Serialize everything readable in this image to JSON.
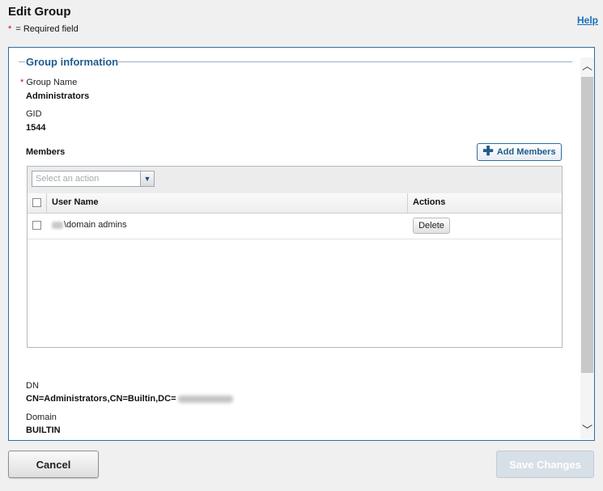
{
  "header": {
    "title": "Edit Group",
    "required_note": "= Required field",
    "required_star": "*",
    "help_link": "Help"
  },
  "group_info": {
    "legend": "Group information",
    "group_name_label": "Group Name",
    "group_name_value": "Administrators",
    "gid_label": "GID",
    "gid_value": "1544",
    "members_label": "Members",
    "add_members_label": "Add Members"
  },
  "members_grid": {
    "action_placeholder": "Select an action",
    "columns": [
      "User Name",
      "Actions"
    ],
    "rows": [
      {
        "user_name": "\\domain admins",
        "action": "Delete"
      }
    ]
  },
  "dn": {
    "label": "DN",
    "value": "CN=Administrators,CN=Builtin,DC="
  },
  "domain": {
    "label": "Domain",
    "value": "BUILTIN"
  },
  "footer": {
    "cancel_label": "Cancel",
    "save_label": "Save Changes"
  },
  "colors": {
    "accent": "#1f5c8d",
    "required": "#d0021b",
    "link": "#1a6ebd",
    "disabled_button": "#d7dfe7"
  }
}
